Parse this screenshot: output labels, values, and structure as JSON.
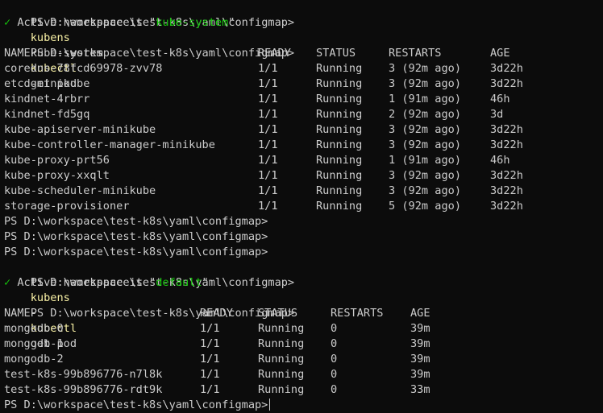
{
  "prompt": "PS D:\\workspace\\test-k8s\\yaml\\configmap>",
  "commands": {
    "kubens_system": {
      "cmd": "kubens",
      "arg": "kube-system"
    },
    "get_pod": {
      "cmd": "kubectl",
      "arg": "get pod"
    },
    "kubens_back": {
      "cmd": "kubens",
      "arg": "-"
    }
  },
  "messages": {
    "check": "✓",
    "active_prefix": "Active namespace is \"",
    "active_suffix": "\"",
    "ns_system": "kube-system",
    "ns_default": "default"
  },
  "table1": {
    "headers": [
      "NAME",
      "READY",
      "STATUS",
      "RESTARTS",
      "AGE"
    ],
    "rows": [
      [
        "coredns-78fcd69978-zvv78",
        "1/1",
        "Running",
        "3 (92m ago)",
        "3d22h"
      ],
      [
        "etcd-minikube",
        "1/1",
        "Running",
        "3 (92m ago)",
        "3d22h"
      ],
      [
        "kindnet-4rbrr",
        "1/1",
        "Running",
        "1 (91m ago)",
        "46h"
      ],
      [
        "kindnet-fd5gq",
        "1/1",
        "Running",
        "2 (92m ago)",
        "3d"
      ],
      [
        "kube-apiserver-minikube",
        "1/1",
        "Running",
        "3 (92m ago)",
        "3d22h"
      ],
      [
        "kube-controller-manager-minikube",
        "1/1",
        "Running",
        "3 (92m ago)",
        "3d22h"
      ],
      [
        "kube-proxy-prt56",
        "1/1",
        "Running",
        "1 (91m ago)",
        "46h"
      ],
      [
        "kube-proxy-xxqlt",
        "1/1",
        "Running",
        "3 (92m ago)",
        "3d22h"
      ],
      [
        "kube-scheduler-minikube",
        "1/1",
        "Running",
        "3 (92m ago)",
        "3d22h"
      ],
      [
        "storage-provisioner",
        "1/1",
        "Running",
        "5 (92m ago)",
        "3d22h"
      ]
    ]
  },
  "table2": {
    "headers": [
      "NAME",
      "READY",
      "STATUS",
      "RESTARTS",
      "AGE"
    ],
    "rows": [
      [
        "mongodb-0",
        "1/1",
        "Running",
        "0",
        "39m"
      ],
      [
        "mongodb-1",
        "1/1",
        "Running",
        "0",
        "39m"
      ],
      [
        "mongodb-2",
        "1/1",
        "Running",
        "0",
        "39m"
      ],
      [
        "test-k8s-99b896776-n7l8k",
        "1/1",
        "Running",
        "0",
        "39m"
      ],
      [
        "test-k8s-99b896776-rdt9k",
        "1/1",
        "Running",
        "0",
        "33m"
      ]
    ]
  },
  "colors": {
    "background": "#0c0c0c",
    "text": "#cccccc",
    "command": "#f9f1a5",
    "success": "#16c60c"
  }
}
